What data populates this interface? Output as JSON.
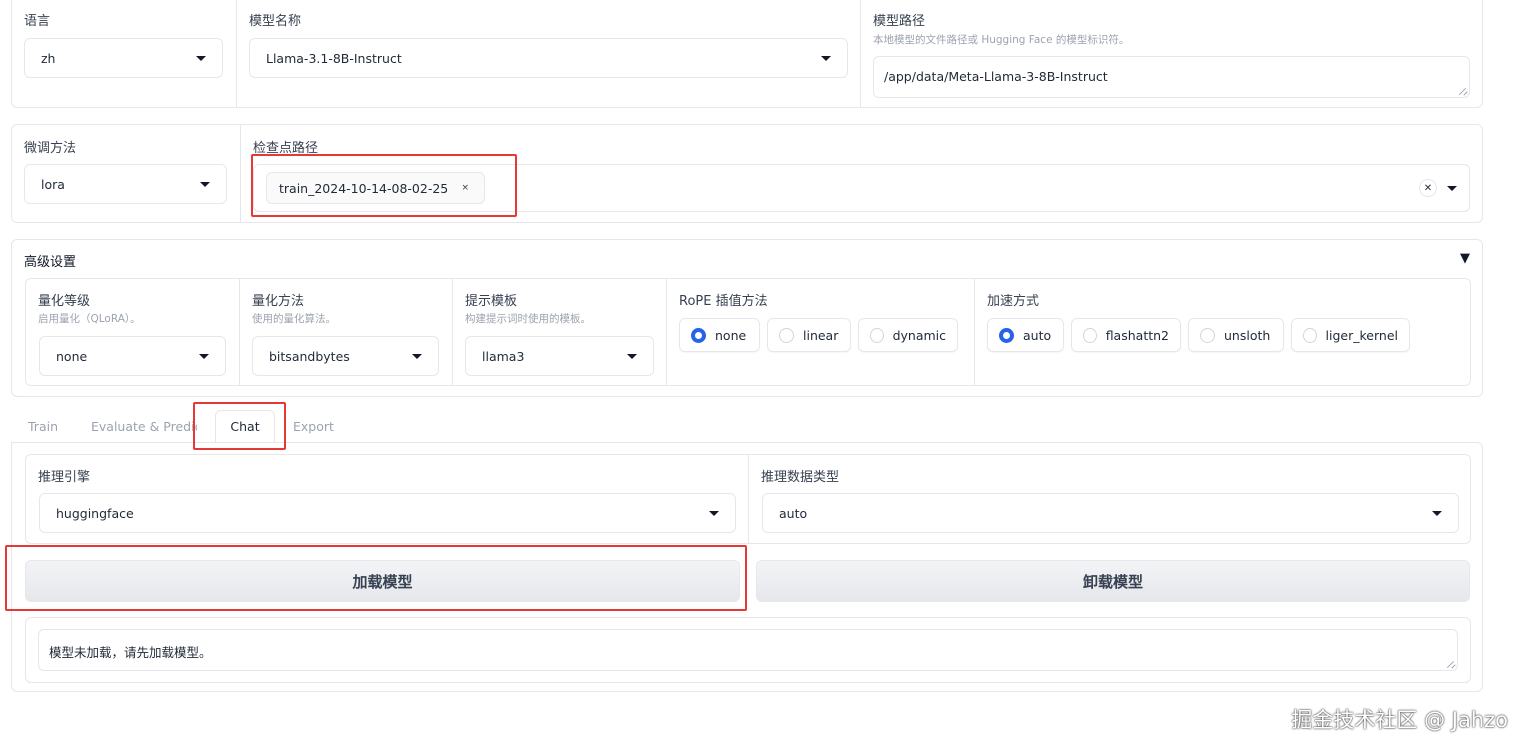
{
  "top": {
    "language": {
      "label": "语言",
      "value": "zh"
    },
    "model_name": {
      "label": "模型名称",
      "value": "Llama-3.1-8B-Instruct"
    },
    "model_path": {
      "label": "模型路径",
      "hint": "本地模型的文件路径或 Hugging Face 的模型标识符。",
      "value": "/app/data/Meta-Llama-3-8B-Instruct"
    }
  },
  "finetune": {
    "method": {
      "label": "微调方法",
      "value": "lora"
    },
    "checkpoint": {
      "label": "检查点路径",
      "chip": "train_2024-10-14-08-02-25",
      "chip_remove": "×",
      "clear": "✕"
    }
  },
  "advanced": {
    "title": "高级设置",
    "toggle": "▼",
    "quant_level": {
      "label": "量化等级",
      "hint": "启用量化（QLoRA）。",
      "value": "none"
    },
    "quant_method": {
      "label": "量化方法",
      "hint": "使用的量化算法。",
      "value": "bitsandbytes"
    },
    "template": {
      "label": "提示模板",
      "hint": "构建提示词时使用的模板。",
      "value": "llama3"
    },
    "rope": {
      "label": "RoPE 插值方法",
      "options": [
        "none",
        "linear",
        "dynamic"
      ],
      "selected": "none"
    },
    "booster": {
      "label": "加速方式",
      "options": [
        "auto",
        "flashattn2",
        "unsloth",
        "liger_kernel"
      ],
      "selected": "auto"
    }
  },
  "tabs": {
    "train": "Train",
    "evaluate": "Evaluate & Predict",
    "chat": "Chat",
    "export": "Export",
    "active": "Chat"
  },
  "chat": {
    "infer_backend": {
      "label": "推理引擎",
      "value": "huggingface"
    },
    "infer_dtype": {
      "label": "推理数据类型",
      "value": "auto"
    },
    "load_button": "加载模型",
    "unload_button": "卸载模型",
    "info": "模型未加载，请先加载模型。"
  },
  "watermark": "掘金技术社区 @ Jahzo",
  "colors": {
    "accent": "#2563eb",
    "highlight": "#e53935",
    "border": "#e5e7eb"
  }
}
